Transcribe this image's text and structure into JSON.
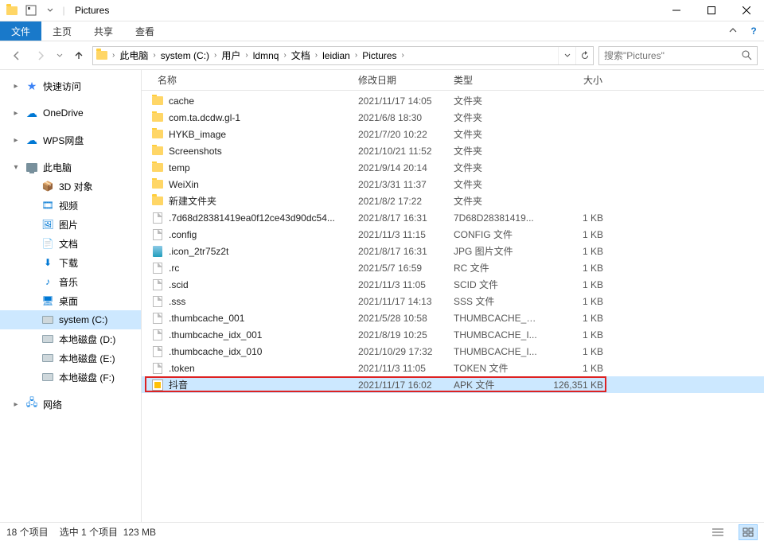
{
  "window": {
    "title": "Pictures"
  },
  "ribbon": {
    "file": "文件",
    "tabs": [
      "主页",
      "共享",
      "查看"
    ]
  },
  "breadcrumbs": [
    "此电脑",
    "system (C:)",
    "用户",
    "ldmnq",
    "文档",
    "leidian",
    "Pictures"
  ],
  "search": {
    "placeholder": "搜索\"Pictures\""
  },
  "tree": {
    "quick": "快速访问",
    "onedrive": "OneDrive",
    "wps": "WPS网盘",
    "pc": "此电脑",
    "pc_children": [
      "3D 对象",
      "视频",
      "图片",
      "文档",
      "下载",
      "音乐",
      "桌面",
      "system (C:)",
      "本地磁盘 (D:)",
      "本地磁盘 (E:)",
      "本地磁盘 (F:)"
    ],
    "network": "网络"
  },
  "columns": {
    "name": "名称",
    "date": "修改日期",
    "type": "类型",
    "size": "大小"
  },
  "files": [
    {
      "icon": "folder",
      "name": "cache",
      "date": "2021/11/17 14:05",
      "type": "文件夹",
      "size": ""
    },
    {
      "icon": "folder",
      "name": "com.ta.dcdw.gl-1",
      "date": "2021/6/8 18:30",
      "type": "文件夹",
      "size": ""
    },
    {
      "icon": "folder",
      "name": "HYKB_image",
      "date": "2021/7/20 10:22",
      "type": "文件夹",
      "size": ""
    },
    {
      "icon": "folder",
      "name": "Screenshots",
      "date": "2021/10/21 11:52",
      "type": "文件夹",
      "size": ""
    },
    {
      "icon": "folder",
      "name": "temp",
      "date": "2021/9/14 20:14",
      "type": "文件夹",
      "size": ""
    },
    {
      "icon": "folder",
      "name": "WeiXin",
      "date": "2021/3/31 11:37",
      "type": "文件夹",
      "size": ""
    },
    {
      "icon": "folder",
      "name": "新建文件夹",
      "date": "2021/8/2 17:22",
      "type": "文件夹",
      "size": ""
    },
    {
      "icon": "file",
      "name": ".7d68d28381419ea0f12ce43d90dc54...",
      "date": "2021/8/17 16:31",
      "type": "7D68D28381419...",
      "size": "1 KB"
    },
    {
      "icon": "file",
      "name": ".config",
      "date": "2021/11/3 11:15",
      "type": "CONFIG 文件",
      "size": "1 KB"
    },
    {
      "icon": "jpg",
      "name": ".icon_2tr75z2t",
      "date": "2021/8/17 16:31",
      "type": "JPG 图片文件",
      "size": "1 KB"
    },
    {
      "icon": "file",
      "name": ".rc",
      "date": "2021/5/7 16:59",
      "type": "RC 文件",
      "size": "1 KB"
    },
    {
      "icon": "file",
      "name": ".scid",
      "date": "2021/11/3 11:05",
      "type": "SCID 文件",
      "size": "1 KB"
    },
    {
      "icon": "file",
      "name": ".sss",
      "date": "2021/11/17 14:13",
      "type": "SSS 文件",
      "size": "1 KB"
    },
    {
      "icon": "file",
      "name": ".thumbcache_001",
      "date": "2021/5/28 10:58",
      "type": "THUMBCACHE_0...",
      "size": "1 KB"
    },
    {
      "icon": "file",
      "name": ".thumbcache_idx_001",
      "date": "2021/8/19 10:25",
      "type": "THUMBCACHE_I...",
      "size": "1 KB"
    },
    {
      "icon": "file",
      "name": ".thumbcache_idx_010",
      "date": "2021/10/29 17:32",
      "type": "THUMBCACHE_I...",
      "size": "1 KB"
    },
    {
      "icon": "file",
      "name": ".token",
      "date": "2021/11/3 11:05",
      "type": "TOKEN 文件",
      "size": "1 KB"
    },
    {
      "icon": "apk",
      "name": "抖音",
      "date": "2021/11/17 16:02",
      "type": "APK 文件",
      "size": "126,351 KB",
      "selected": true
    }
  ],
  "status": {
    "count": "18 个项目",
    "selection": "选中 1 个项目",
    "sel_size": "123 MB"
  }
}
